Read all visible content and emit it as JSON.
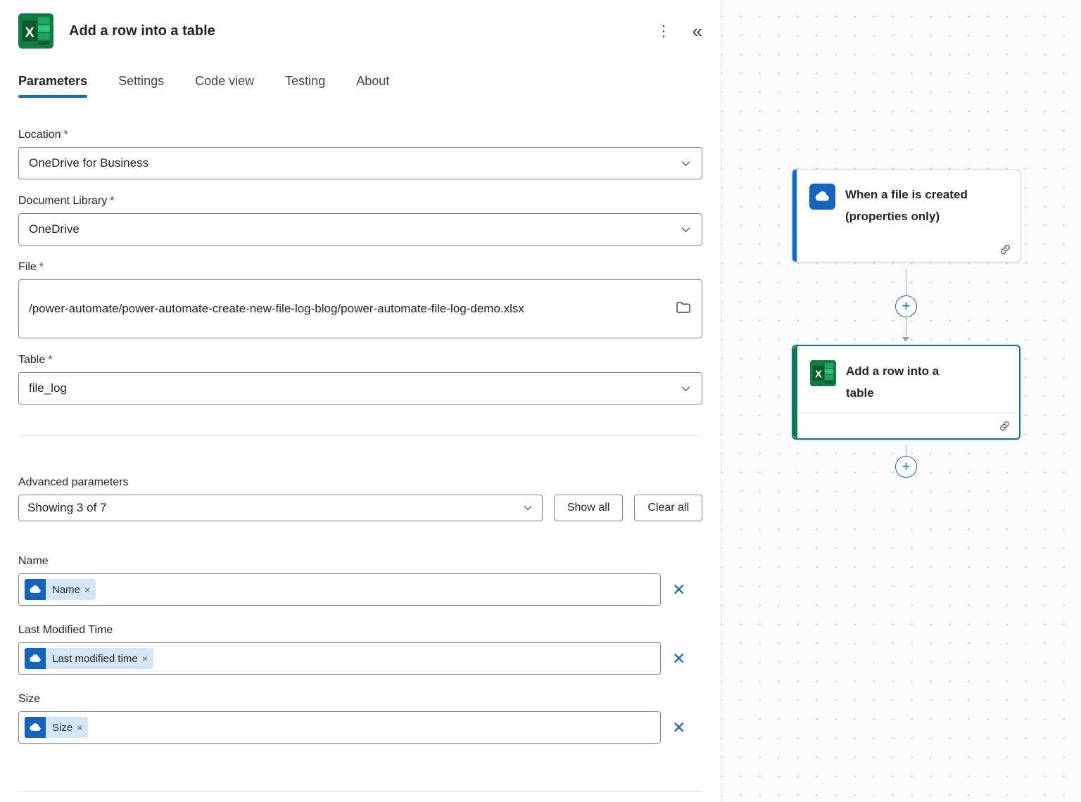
{
  "icons": {
    "kebab": "⋮",
    "collapse": "«",
    "dismiss": "✕",
    "pill_remove": "×",
    "plus": "+"
  },
  "panel": {
    "title": "Add a row into a table",
    "tabs": [
      {
        "label": "Parameters",
        "active": true
      },
      {
        "label": "Settings",
        "active": false
      },
      {
        "label": "Code view",
        "active": false
      },
      {
        "label": "Testing",
        "active": false
      },
      {
        "label": "About",
        "active": false
      }
    ],
    "fields": {
      "location": {
        "label": "Location",
        "required": "*",
        "value": "OneDrive for Business"
      },
      "document_library": {
        "label": "Document Library",
        "required": "*",
        "value": "OneDrive"
      },
      "file": {
        "label": "File",
        "required": "*",
        "value": "/power-automate/power-automate-create-new-file-log-blog/power-automate-file-log-demo.xlsx"
      },
      "table": {
        "label": "Table",
        "required": "*",
        "value": "file_log"
      }
    },
    "advanced": {
      "label": "Advanced parameters",
      "dropdown_value": "Showing 3 of 7",
      "show_all": "Show all",
      "clear_all": "Clear all"
    },
    "dynamic_fields": [
      {
        "label": "Name",
        "pill": "Name"
      },
      {
        "label": "Last Modified Time",
        "pill": "Last modified time"
      },
      {
        "label": "Size",
        "pill": "Size"
      }
    ]
  },
  "canvas": {
    "nodes": [
      {
        "title": "When a file is created (properties only)",
        "icon": "onedrive-cloud"
      },
      {
        "title": "Add a row into a table",
        "icon": "excel",
        "selected": true
      }
    ]
  },
  "colors": {
    "accent_blue": "#0f6cbd",
    "excel_green": "#107c41",
    "pill_bg": "#d3e7f9",
    "required_red": "#a4262c"
  }
}
